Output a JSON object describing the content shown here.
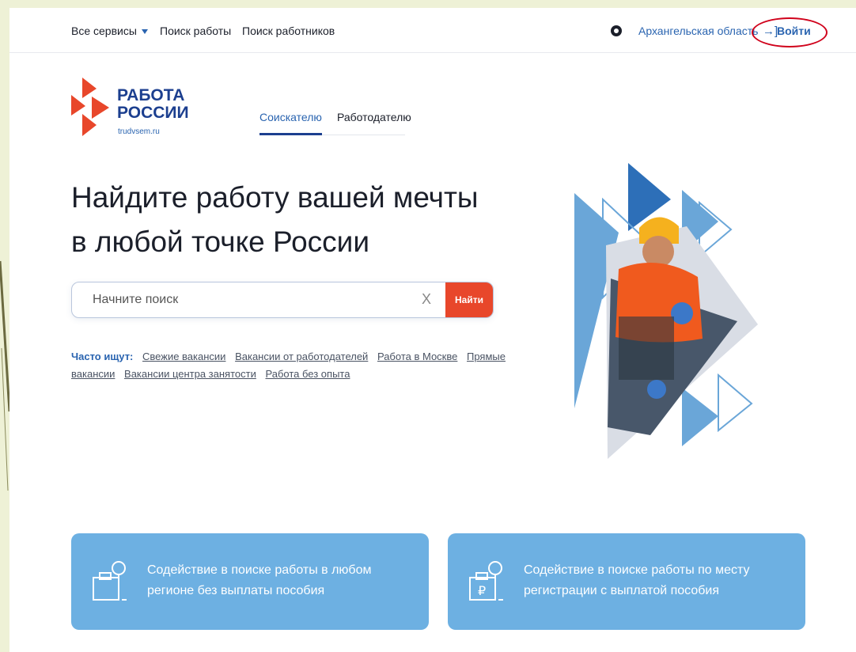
{
  "nav": {
    "all_services": "Все сервисы",
    "job_search": "Поиск работы",
    "worker_search": "Поиск работников",
    "region": "Архангельская область",
    "login": "Войти",
    "login_arrow": "→]"
  },
  "logo": {
    "line1": "РАБОТА",
    "line2": "РОССИИ",
    "site": "trudvsem.ru"
  },
  "tabs": [
    "Соискателю",
    "Работодателю"
  ],
  "hero": {
    "line1": "Найдите работу вашей мечты",
    "line2": "в любой точке России"
  },
  "search": {
    "placeholder": "Начните поиск",
    "clear": "X",
    "button": "Найти"
  },
  "popular": {
    "label": "Часто ищут:",
    "links": [
      "Свежие вакансии",
      "Вакансии от работодателей",
      "Работа в Москве",
      "Прямые вакансии",
      "Вакансии центра занятости",
      "Работа без опыта"
    ]
  },
  "cards": [
    {
      "text": "Содействие в поиске работы в любом регионе без выплаты пособия",
      "icon": "briefcase-search-icon"
    },
    {
      "text": "Содействие в поиске работы по месту регистрации с выплатой пособия",
      "icon": "ruble-briefcase-search-icon"
    }
  ],
  "colors": {
    "accent": "#2a64b0",
    "brand_dark": "#1c3f8f",
    "search_button": "#e8472b",
    "card": "#6db0e2",
    "highlight_ring": "#d0021b"
  }
}
